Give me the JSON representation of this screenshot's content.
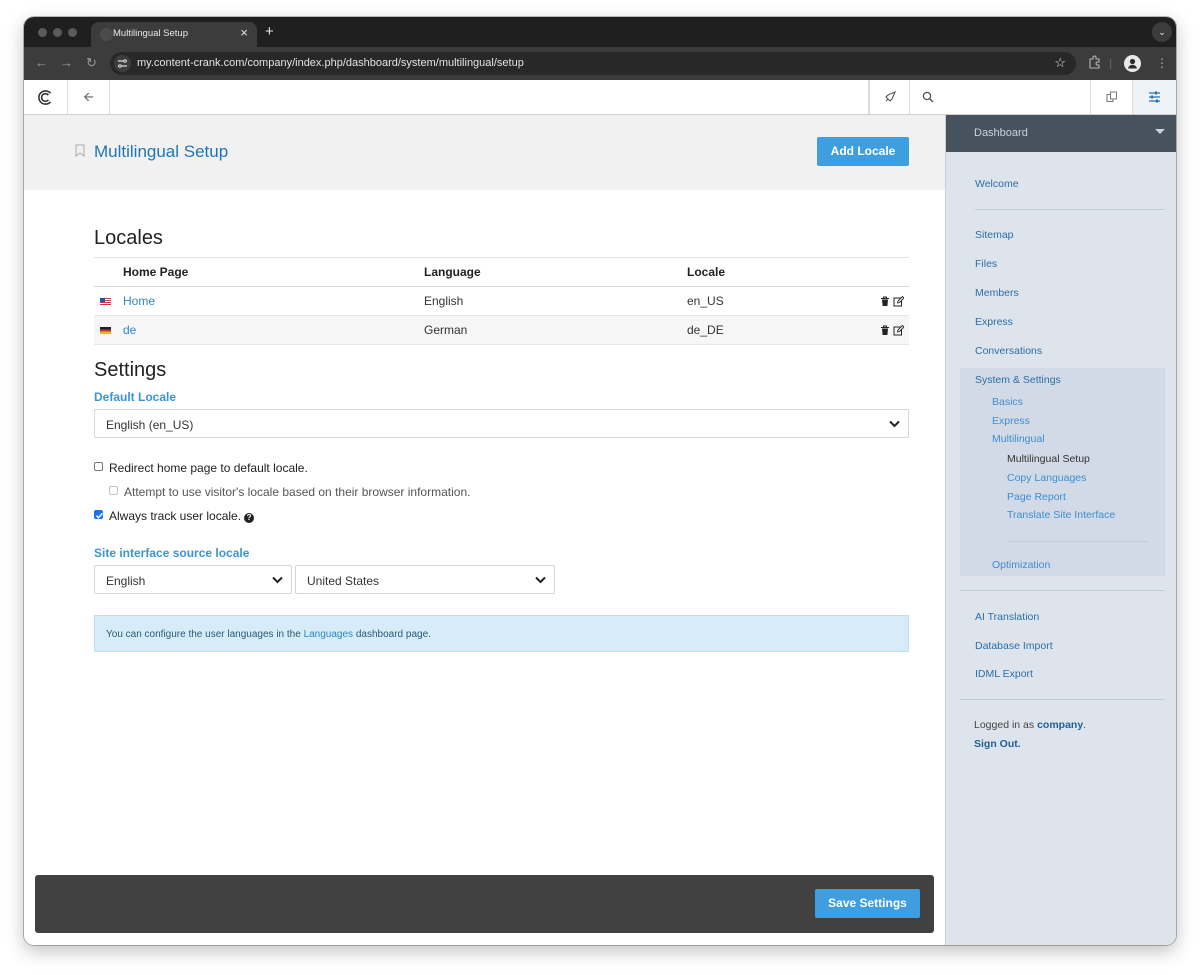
{
  "browser": {
    "tab_title": "Multilingual Setup",
    "tab_close": "×",
    "new_tab": "+",
    "url": "my.content-crank.com/company/index.php/dashboard/system/multilingual/setup"
  },
  "page": {
    "title": "Multilingual Setup",
    "add_locale_label": "Add Locale"
  },
  "locales": {
    "heading": "Locales",
    "columns": [
      "Home Page",
      "Language",
      "Locale"
    ],
    "rows": [
      {
        "home": "Home",
        "language": "English",
        "locale": "en_US",
        "flag": "us"
      },
      {
        "home": "de",
        "language": "German",
        "locale": "de_DE",
        "flag": "de"
      }
    ]
  },
  "settings": {
    "heading": "Settings",
    "default_locale_label": "Default Locale",
    "default_locale_value": "English (en_US)",
    "redirect_label": "Redirect home page to default locale.",
    "redirect_checked": false,
    "browser_locale_label": "Attempt to use visitor's locale based on their browser information.",
    "browser_locale_checked": false,
    "track_label": "Always track user locale.",
    "track_checked": true,
    "help_glyph": "?",
    "source_locale_label": "Site interface source locale",
    "source_language": "English",
    "source_country": "United States",
    "info_prefix": "You can configure the user languages in the ",
    "info_link": "Languages",
    "info_suffix": " dashboard page.",
    "save_label": "Save Settings"
  },
  "panel": {
    "header": "Dashboard",
    "welcome": "Welcome",
    "items": [
      "Sitemap",
      "Files",
      "Members",
      "Express",
      "Conversations"
    ],
    "system_settings": "System & Settings",
    "system_children": [
      "Basics",
      "Express",
      "Multilingual"
    ],
    "multilingual_children": [
      "Multilingual Setup",
      "Copy Languages",
      "Page Report",
      "Translate Site Interface"
    ],
    "optimization": "Optimization",
    "extra_items": [
      "AI Translation",
      "Database Import",
      "IDML Export"
    ],
    "logged_in_prefix": "Logged in as ",
    "logged_in_user": "company",
    "logged_in_suffix": ".",
    "sign_out": "Sign Out."
  },
  "colors": {
    "primary_button": "#3e9ee0",
    "link": "#2f86c8",
    "panel_bg": "#dee4ec",
    "panel_header": "#46525e",
    "footer_bar": "#414141"
  }
}
